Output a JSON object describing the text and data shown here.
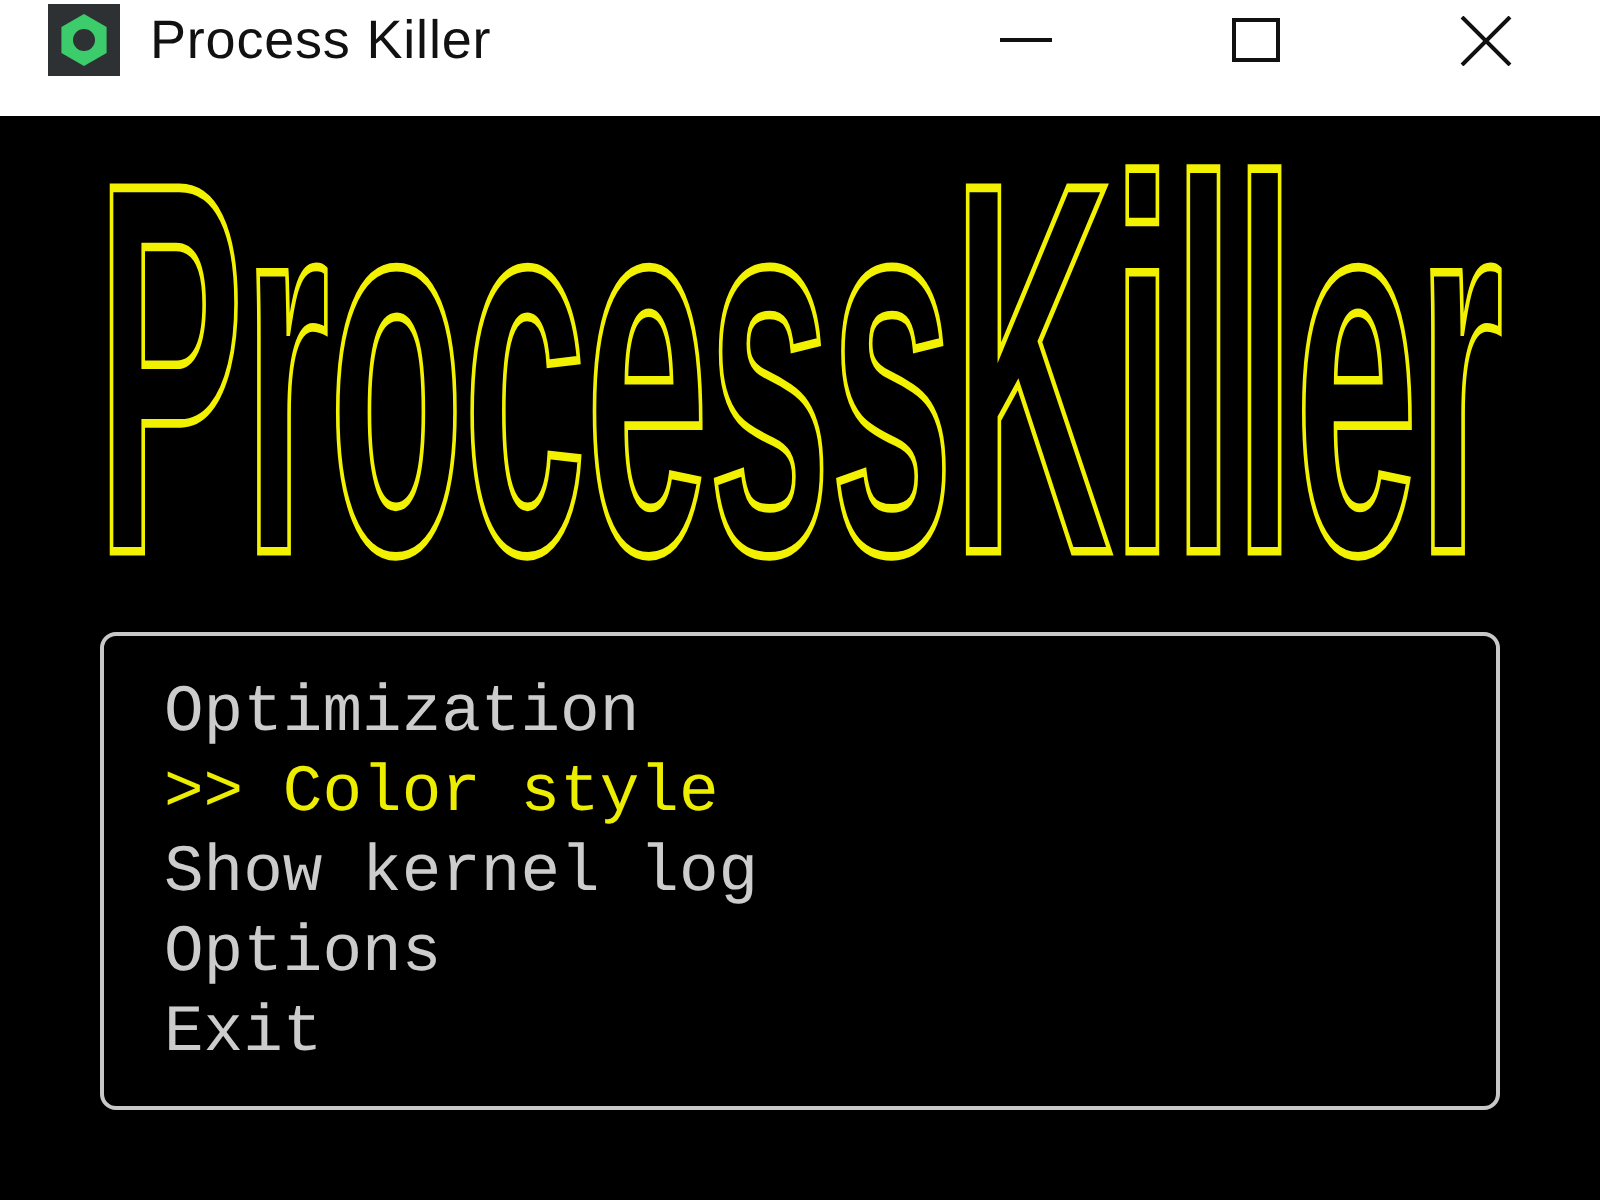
{
  "window": {
    "title": "Process Killer"
  },
  "logo": {
    "text": "ProcessKiller"
  },
  "menu": {
    "cursor": ">>",
    "items": [
      {
        "label": "Optimization",
        "selected": false
      },
      {
        "label": "Color style",
        "selected": true
      },
      {
        "label": "Show kernel log",
        "selected": false
      },
      {
        "label": "Options",
        "selected": false
      },
      {
        "label": "Exit",
        "selected": false
      }
    ]
  }
}
